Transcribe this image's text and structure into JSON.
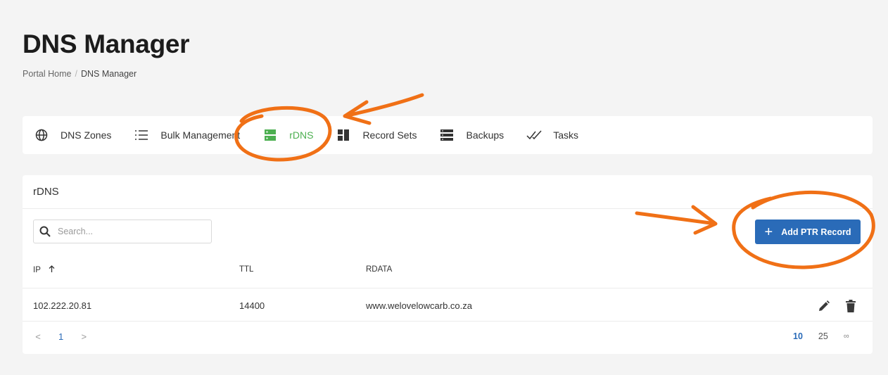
{
  "page": {
    "title": "DNS Manager",
    "breadcrumb": {
      "home": "Portal Home",
      "separator": "/",
      "current": "DNS Manager"
    }
  },
  "tabs": [
    {
      "label": "DNS Zones",
      "icon": "globe-icon",
      "active": false
    },
    {
      "label": "Bulk Management",
      "icon": "list-icon",
      "active": false
    },
    {
      "label": "rDNS",
      "icon": "server-icon",
      "active": true
    },
    {
      "label": "Record Sets",
      "icon": "grid-icon",
      "active": false
    },
    {
      "label": "Backups",
      "icon": "database-icon",
      "active": false
    },
    {
      "label": "Tasks",
      "icon": "double-check-icon",
      "active": false
    }
  ],
  "card": {
    "title": "rDNS",
    "search_placeholder": "Search...",
    "add_button_label": "Add PTR Record",
    "columns": {
      "ip": "IP",
      "ttl": "TTL",
      "rdata": "RDATA"
    },
    "rows": [
      {
        "ip": "102.222.20.81",
        "ttl": "14400",
        "rdata": "www.welovelowcarb.co.za"
      }
    ],
    "pagination": {
      "prev": "<",
      "page": "1",
      "next": ">",
      "page_sizes": [
        "10",
        "25",
        "∞"
      ],
      "selected_size": "10"
    }
  },
  "colors": {
    "background": "#f4f4f4",
    "active_tab": "#4caf50",
    "primary_button": "#2a6bb8",
    "annotation": "#f07016"
  }
}
